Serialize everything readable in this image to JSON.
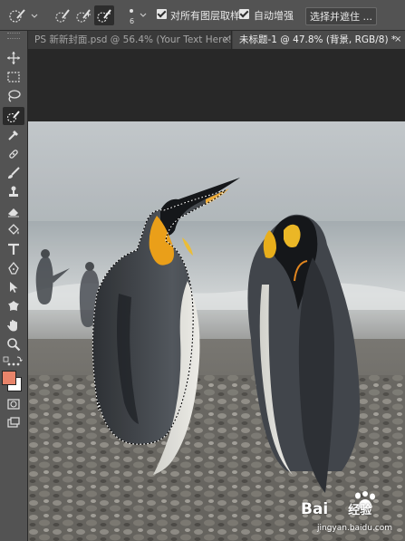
{
  "options_bar": {
    "brush_size": "6",
    "sample_all_layers_label": "对所有图层取样",
    "auto_enhance_label": "自动增强",
    "select_and_mask_button": "选择并遮住 ..."
  },
  "tabs": [
    {
      "title": "PS 新新封面.psd @ 56.4% (Your Text Here!, ...",
      "close": "×"
    },
    {
      "title": "未标题-1 @ 47.8% (背景, RGB/8) *",
      "close": "×"
    }
  ],
  "toolbar": {
    "tools": [
      "move-tool",
      "marquee-tool",
      "lasso-tool",
      "quick-selection-tool",
      "eyedropper-tool",
      "healing-brush-tool",
      "brush-tool",
      "clone-stamp-tool",
      "eraser-tool",
      "gradient-tool",
      "type-tool",
      "pen-tool",
      "path-selection-tool",
      "hand-tool",
      "custom-shape-tool",
      "zoom-tool",
      "more-tools"
    ],
    "foreground_color": "#e8846a",
    "background_color": "#ffffff"
  },
  "watermark": {
    "brand": "Bai",
    "brand_mid": "du",
    "brand_suffix": "经验",
    "url": "jingyan.baidu.com"
  }
}
